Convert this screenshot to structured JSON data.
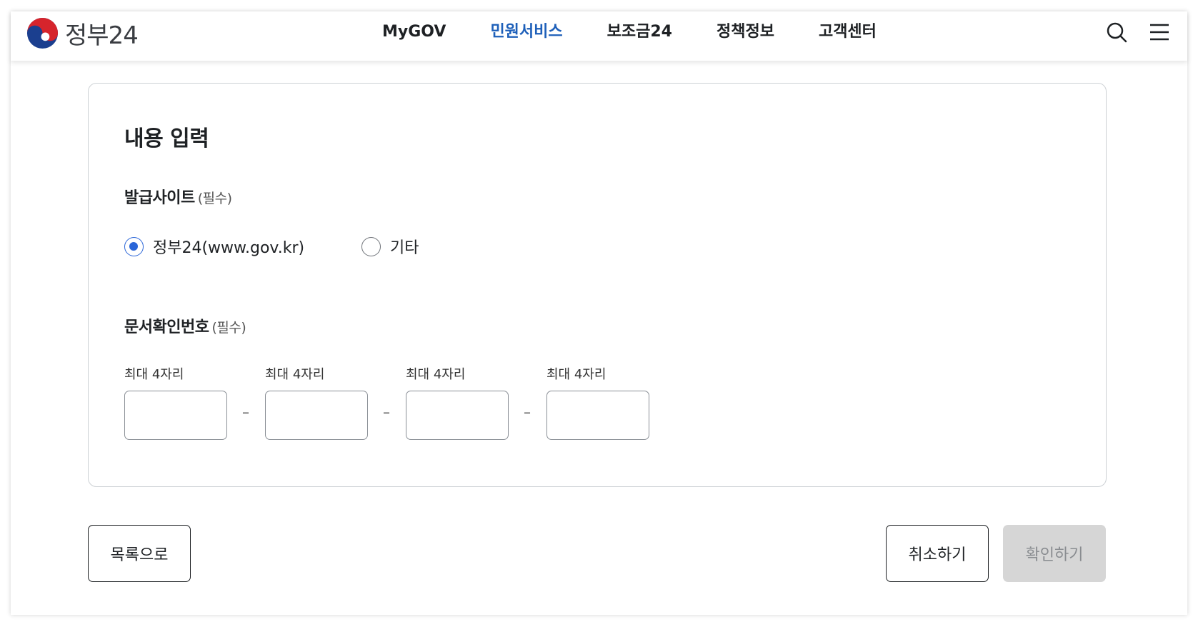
{
  "header": {
    "logo_text": "정부24",
    "nav": [
      {
        "label": "MyGOV"
      },
      {
        "label": "민원서비스",
        "active": true
      },
      {
        "label": "보조금24"
      },
      {
        "label": "정책정보"
      },
      {
        "label": "고객센터"
      }
    ],
    "icons": [
      "search-icon",
      "menu-icon"
    ]
  },
  "form": {
    "title": "내용 입력",
    "issue_site": {
      "label": "발급사이트",
      "required": "(필수)",
      "options": [
        {
          "label": "정부24(www.gov.kr)",
          "checked": true
        },
        {
          "label": "기타",
          "checked": false
        }
      ]
    },
    "doc_number": {
      "label": "문서확인번호",
      "required": "(필수)",
      "fields": [
        {
          "label": "최대 4자리",
          "value": ""
        },
        {
          "label": "최대 4자리",
          "value": ""
        },
        {
          "label": "최대 4자리",
          "value": ""
        },
        {
          "label": "최대 4자리",
          "value": ""
        }
      ],
      "separator": "–"
    }
  },
  "buttons": {
    "list": "목록으로",
    "cancel": "취소하기",
    "confirm": "확인하기"
  },
  "colors": {
    "accent": "#1d5fb9",
    "radio_checked": "#2b66d8",
    "disabled_bg": "#d6d6d6"
  }
}
